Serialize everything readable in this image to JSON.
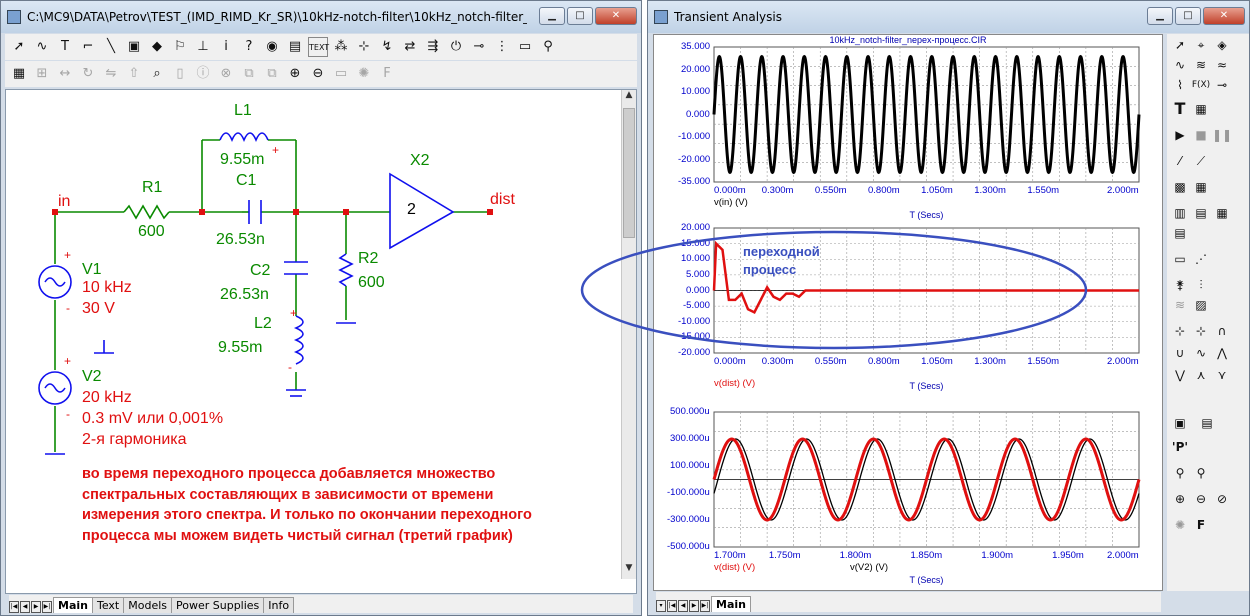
{
  "left_window": {
    "title": "C:\\MC9\\DATA\\Petrov\\TEST_(IMD_RIMD_Kr_SR)\\10kHz-notch-filter\\10kHz_notch-filter_nepex-процесс.CIR",
    "tabs": [
      "Main",
      "Text",
      "Models",
      "Power Supplies",
      "Info"
    ],
    "labels": {
      "node_in": "in",
      "node_dist": "dist",
      "r1_name": "R1",
      "r1_value": "600",
      "l1_name": "L1",
      "l1_value": "9.55m",
      "c1_name": "C1",
      "c1_value": "26.53n",
      "x2_name": "X2",
      "x2_pin": "2",
      "r2_name": "R2",
      "r2_value": "600",
      "c2_name": "C2",
      "c2_value": "26.53n",
      "l2_name": "L2",
      "l2_value": "9.55m",
      "v1_name": "V1",
      "v1_freq": "10 kHz",
      "v1_amp": "30 V",
      "v2_name": "V2",
      "v2_freq": "20 kHz",
      "v2_amp": "0.3 mV или 0,001%",
      "v2_note": "2-я гармоника",
      "plus": "+",
      "minus": "-"
    },
    "note_lines": [
      "во время переходного процесса добавляется множество",
      "спектральных составляющих в зависимости от времени",
      "измерения этого спектра. И только по окончании переходного",
      "процесса мы можем видеть чистый сигнал (третий график)"
    ]
  },
  "right_window": {
    "title": "Transient Analysis",
    "tabs": [
      "Main"
    ],
    "plot_title": "10kHz_notch-filter_nepex-процесс.CIR",
    "annotation_line1": "переходной",
    "annotation_line2": "процесс",
    "colors": {
      "black_trace": "#000000",
      "red_trace": "#e01010",
      "ellipse": "#3a4fbf",
      "grid": "#9a9a9a"
    }
  },
  "chart_data": [
    {
      "type": "line",
      "series": [
        {
          "name": "v(in) (V)",
          "description": "10 kHz sine, amplitude 30"
        }
      ],
      "x_ticks": [
        "0.000m",
        "0.300m",
        "0.550m",
        "0.800m",
        "1.050m",
        "1.300m",
        "1.550m",
        "2.000m"
      ],
      "y_ticks": [
        "35.000",
        "20.000",
        "10.000",
        "0.000",
        "-10.000",
        "-20.000",
        "-35.000"
      ],
      "xlabel": "T (Secs)",
      "ylabel": "v(in) (V)",
      "xlim": [
        0,
        2.0
      ],
      "ylim": [
        -35,
        35
      ]
    },
    {
      "type": "line",
      "series": [
        {
          "name": "v(dist) (V)",
          "points": [
            [
              0.0,
              0
            ],
            [
              0.01,
              15
            ],
            [
              0.04,
              13
            ],
            [
              0.07,
              -3
            ],
            [
              0.1,
              -3
            ],
            [
              0.13,
              -1
            ],
            [
              0.16,
              -6
            ],
            [
              0.19,
              -7
            ],
            [
              0.22,
              -3
            ],
            [
              0.25,
              1
            ],
            [
              0.28,
              -2
            ],
            [
              0.31,
              -3
            ],
            [
              0.34,
              -1
            ],
            [
              0.37,
              -1
            ],
            [
              0.4,
              -2
            ],
            [
              0.43,
              0
            ],
            [
              0.5,
              0
            ],
            [
              2.0,
              0
            ]
          ]
        }
      ],
      "x_ticks": [
        "0.000m",
        "0.300m",
        "0.550m",
        "0.800m",
        "1.050m",
        "1.300m",
        "1.550m",
        "2.000m"
      ],
      "y_ticks": [
        "20.000",
        "15.000",
        "10.000",
        "5.000",
        "0.000",
        "-5.000",
        "-10.000",
        "-15.000",
        "-20.000"
      ],
      "xlabel": "T (Secs)",
      "ylabel": "v(dist) (V)",
      "xlim": [
        0,
        2.0
      ],
      "ylim": [
        -20,
        20
      ]
    },
    {
      "type": "line",
      "series": [
        {
          "name": "v(dist) (V)",
          "description": "10 kHz sine, amplitude ~300u, red, thicker"
        },
        {
          "name": "v(V2) (V)",
          "description": "10 kHz sine, amplitude ~300u, black, slightly phase shifted"
        }
      ],
      "x_ticks": [
        "1.700m",
        "1.750m",
        "1.800m",
        "1.850m",
        "1.900m",
        "1.950m",
        "2.000m"
      ],
      "y_ticks": [
        "500.000u",
        "300.000u",
        "100.000u",
        "-100.000u",
        "-300.000u",
        "-500.000u"
      ],
      "xlabel": "T (Secs)",
      "xlim": [
        1.7,
        2.0
      ],
      "ylim": [
        -500,
        500
      ]
    }
  ]
}
